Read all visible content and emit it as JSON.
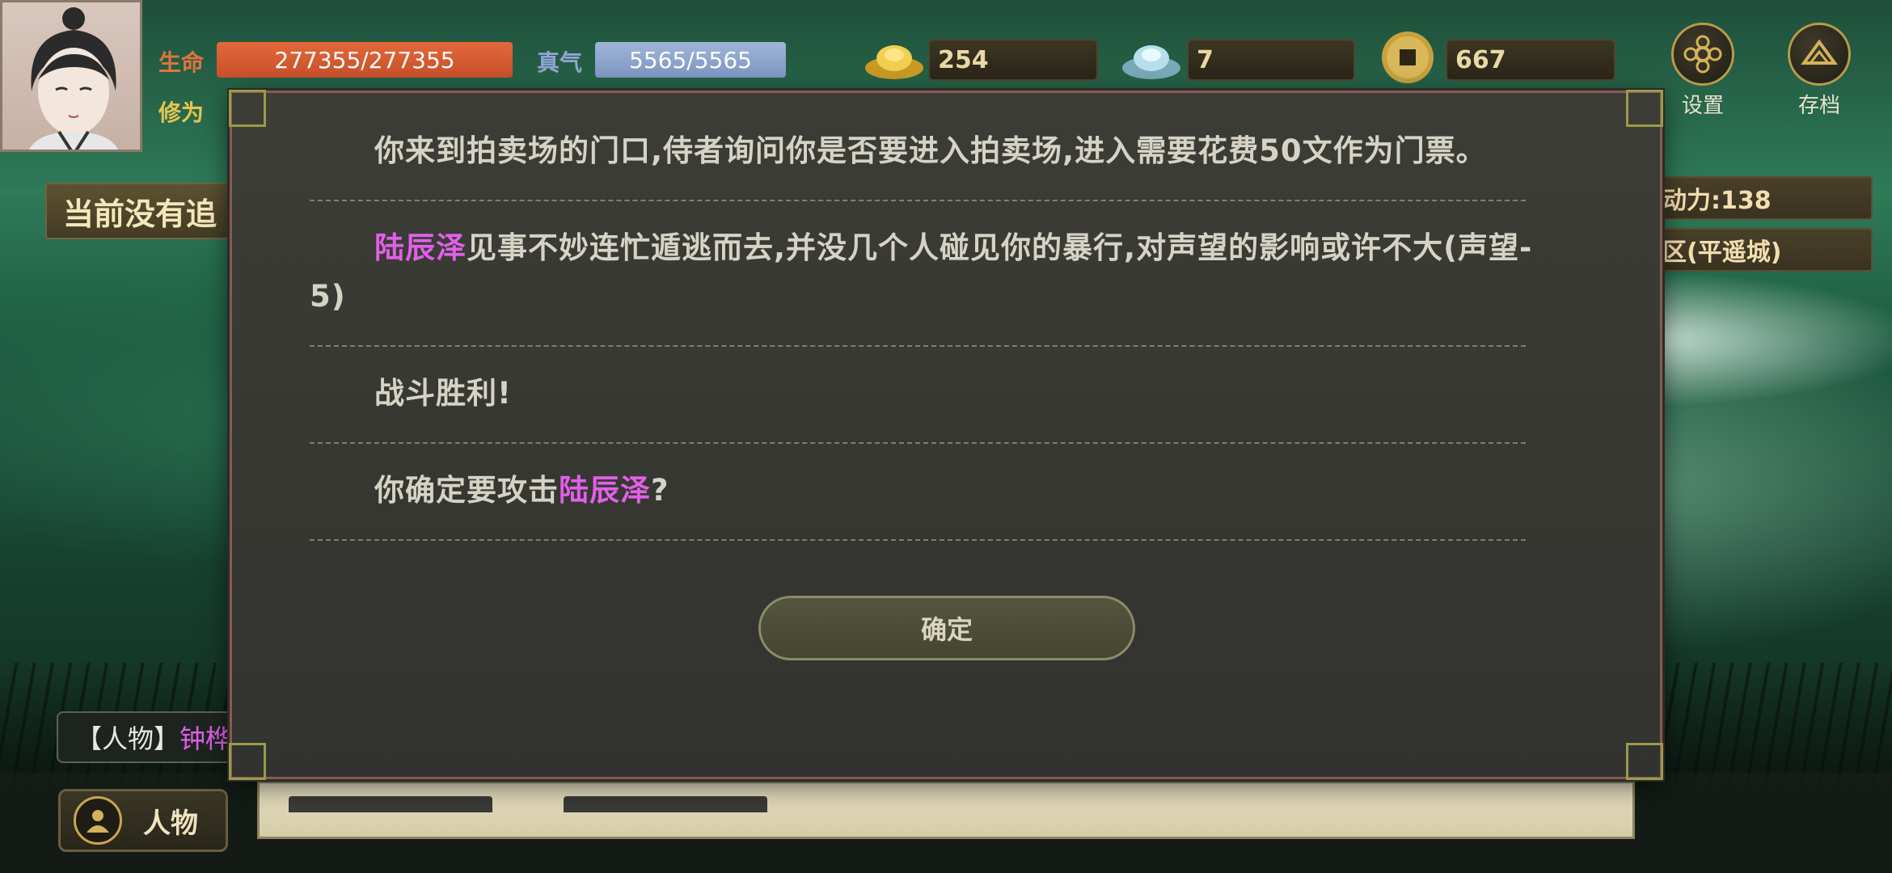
{
  "player": {
    "hp_label": "生命",
    "hp_value": "277355/277355",
    "qi_label": "真气",
    "qi_value": "5565/5565",
    "cultivation_label": "修为"
  },
  "currency": {
    "gold": "254",
    "silver": "7",
    "copper": "667"
  },
  "hud": {
    "settings_label": "设置",
    "save_label": "存档"
  },
  "side": {
    "left_tag": "当前没有追",
    "action_points": "动力:138",
    "location": "区(平遥城)"
  },
  "person_tag": {
    "prefix": "【人物】",
    "name": "钟桦"
  },
  "bottom": {
    "character_button": "人物"
  },
  "dialog": {
    "messages": [
      {
        "text": "你来到拍卖场的门口,侍者询问你是否要进入拍卖场,进入需要花费50文作为门票。"
      },
      {
        "name": "陆辰泽",
        "text": "见事不妙连忙遁逃而去,并没几个人碰见你的暴行,对声望的影响或许不大(声望-",
        "text2": "5)"
      },
      {
        "text": "战斗胜利!"
      },
      {
        "text_before": "你确定要攻击",
        "name": "陆辰泽",
        "text_after": "?"
      }
    ],
    "confirm_label": "确定"
  },
  "colors": {
    "accent_name": "#e060e8",
    "hp_bar": "#d65a30",
    "qi_bar": "#8ea6d0",
    "gold_text": "#e9d9a4"
  }
}
